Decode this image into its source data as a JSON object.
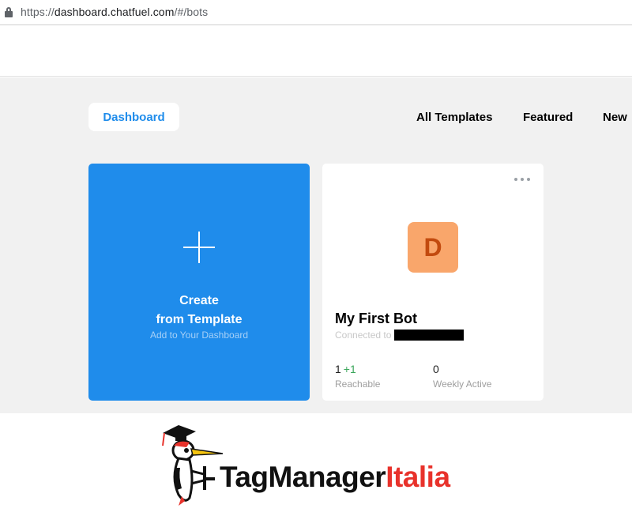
{
  "browser": {
    "url_prefix": "https://",
    "url_host": "dashboard.chatfuel.com",
    "url_path": "/#/bots"
  },
  "nav": {
    "dashboard_label": "Dashboard",
    "tabs": [
      "All Templates",
      "Featured",
      "New"
    ]
  },
  "create_card": {
    "title_line1": "Create",
    "title_line2": "from Template",
    "subtitle": "Add to Your Dashboard"
  },
  "bot_card": {
    "avatar_letter": "D",
    "name": "My First Bot",
    "connected_label": "Connected to",
    "stats": [
      {
        "value": "1",
        "delta": "+1",
        "label": "Reachable"
      },
      {
        "value": "0",
        "delta": "",
        "label": "Weekly Active"
      }
    ]
  },
  "watermark": {
    "brand_dark": "TagManager",
    "brand_red": "Italia"
  },
  "colors": {
    "accent": "#1f8ceb",
    "avatar_bg": "#f9a66b",
    "avatar_text": "#c24a0e",
    "positive": "#3aa65a",
    "brand_red": "#e8322b"
  }
}
